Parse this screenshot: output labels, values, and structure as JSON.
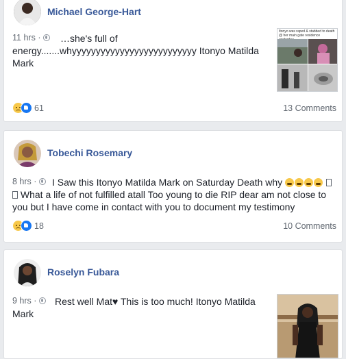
{
  "posts": [
    {
      "author": "Michael George-Hart",
      "time": "11 hrs",
      "dot": "·",
      "text": "…she's full of energy.......whyyyyyyyyyyyyyyyyyyyyyyyyyy Itonyo Matilda Mark",
      "reaction_count": "61",
      "comments": "13 Comments",
      "thumb_caption": "Itonyo was raped & stabbed to death @ her main gate residence yesterday",
      "avatar_color": "#3a3a3a"
    },
    {
      "author": "Tobechi Rosemary",
      "time": "8 hrs",
      "dot": "·",
      "text_before_emoji": "I Saw this Itonyo Matilda Mark on Saturday Death why",
      "text_after_emoji": "What a life of not fulfilled atall Too young to die RIP dear am not close to you but I have come in contact with you to document my testimony",
      "reaction_count": "18",
      "comments": "10 Comments",
      "avatar_color": "#b06a5a"
    },
    {
      "author": "Roselyn Fubara",
      "time": "9 hrs",
      "dot": "·",
      "text_before_heart": "Rest well Mat",
      "heart": "♥",
      "text_after_heart": "This is too much! Itonyo Matilda Mark",
      "avatar_color": "#2b2b2b"
    }
  ],
  "colors": {
    "background": "#e9ebee",
    "name_link": "#385898",
    "meta": "#606770",
    "body_text": "#1d2129"
  },
  "icons": [
    "globe-icon",
    "sad-reaction-icon",
    "like-reaction-icon",
    "crying-emoji-icon",
    "heart-icon"
  ]
}
